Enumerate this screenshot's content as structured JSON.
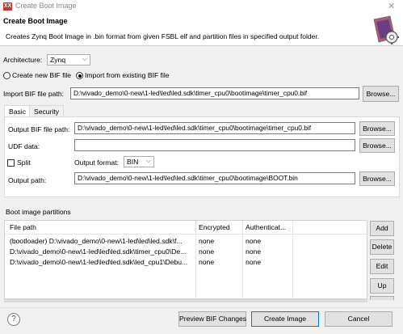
{
  "window": {
    "title": "Create Boot Image",
    "app_icon_text": "XX",
    "close_glyph": "✕"
  },
  "header": {
    "title": "Create Boot Image",
    "description": "Creates Zynq Boot Image in .bin format from given FSBL elf and partition files in specified output folder."
  },
  "architecture": {
    "label": "Architecture:",
    "value": "Zynq",
    "chevron": "⌵"
  },
  "mode": {
    "create_new_label": "Create new BIF file",
    "import_label": "Import from existing BIF file",
    "selected": "import"
  },
  "import_bif": {
    "label": "Import BIF file path:",
    "value": "D:\\vivado_demo\\0-new\\1-led\\led\\led.sdk\\timer_cpu0\\bootimage\\timer_cpu0.bif",
    "browse_label": "Browse..."
  },
  "tabs": [
    {
      "label": "Basic",
      "selected": true
    },
    {
      "label": "Security",
      "selected": false
    }
  ],
  "basic": {
    "output_bif_label": "Output BIF file path:",
    "output_bif_value": "D:\\vivado_demo\\0-new\\1-led\\led\\led.sdk\\timer_cpu0\\bootimage\\timer_cpu0.bif",
    "udf_label": "UDF data:",
    "udf_value": "",
    "split_label": "Split",
    "output_format_label": "Output format:",
    "output_format_value": "BIN",
    "output_path_label": "Output path:",
    "output_path_value": "D:\\vivado_demo\\0-new\\1-led\\led\\led.sdk\\timer_cpu0\\bootimage\\BOOT.bin",
    "browse_label": "Browse..."
  },
  "partitions": {
    "section_label": "Boot image partitions",
    "columns": [
      "File path",
      "Encrypted",
      "Authenticat..."
    ],
    "rows": [
      [
        "(bootloader) D:\\vivado_demo\\0-new\\1-led\\led\\led.sdk\\f...",
        "none",
        "none"
      ],
      [
        "D:\\vivado_demo\\0-new\\1-led\\led\\led.sdk\\timer_cpu0\\De...",
        "none",
        "none"
      ],
      [
        "D:\\vivado_demo\\0-new\\1-led\\led\\led.sdk\\led_cpu1\\Debu...",
        "none",
        "none"
      ]
    ],
    "buttons": {
      "add": "Add",
      "delete": "Delete",
      "edit": "Edit",
      "up": "Up"
    }
  },
  "footer": {
    "help_glyph": "?",
    "preview_label": "Preview BIF Changes",
    "create_label": "Create Image",
    "cancel_label": "Cancel"
  }
}
